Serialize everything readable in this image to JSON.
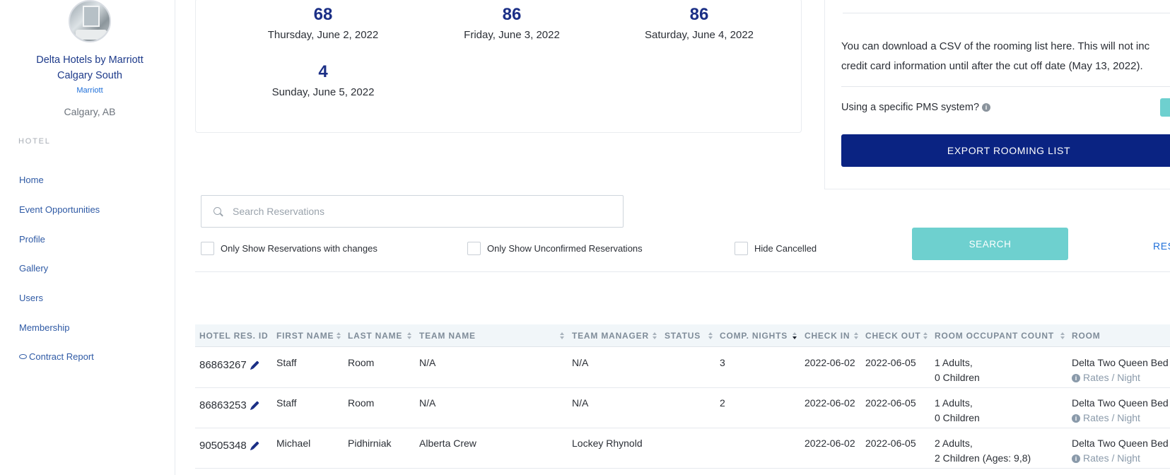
{
  "sidebar": {
    "hotel_name_line1": "Delta Hotels by Marriott",
    "hotel_name_line2": "Calgary South",
    "brand": "Marriott",
    "city": "Calgary, AB",
    "section_label": "HOTEL",
    "items": [
      {
        "label": "Home"
      },
      {
        "label": "Event Opportunities"
      },
      {
        "label": "Profile"
      },
      {
        "label": "Gallery"
      },
      {
        "label": "Users"
      },
      {
        "label": "Membership"
      },
      {
        "label": "Contract Report"
      }
    ]
  },
  "stats": [
    {
      "count": "68",
      "date": "Thursday, June 2, 2022"
    },
    {
      "count": "86",
      "date": "Friday, June 3, 2022"
    },
    {
      "count": "86",
      "date": "Saturday, June 4, 2022"
    },
    {
      "count": "4",
      "date": "Sunday, June 5, 2022"
    }
  ],
  "export": {
    "text_line1": "You can download a CSV of the rooming list here. This will not inc",
    "text_line2": "credit card information until after the cut off date (May 13, 2022).",
    "pms_label": "Using a specific PMS system?",
    "info_glyph": "i",
    "button_label": "EXPORT ROOMING LIST"
  },
  "search": {
    "placeholder": "Search Reservations",
    "value": "",
    "filters": [
      {
        "label": "Only Show Reservations with changes"
      },
      {
        "label": "Only Show Unconfirmed Reservations"
      },
      {
        "label": "Hide Cancelled"
      }
    ],
    "search_button": "SEARCH",
    "reset_link": "RES"
  },
  "table": {
    "headers": [
      "HOTEL RES. ID",
      "FIRST NAME",
      "LAST NAME",
      "TEAM NAME",
      "TEAM MANAGER",
      "STATUS",
      "COMP. NIGHTS",
      "CHECK IN",
      "CHECK OUT",
      "ROOM OCCUPANT COUNT",
      "ROOM"
    ],
    "rows": [
      {
        "id": "86863267",
        "first": "Staff",
        "last": "Room",
        "team": "N/A",
        "manager": "N/A",
        "status": "",
        "comp": "3",
        "checkin": "2022-06-02",
        "checkout": "2022-06-05",
        "occ1": "1 Adults,",
        "occ2": "0 Children",
        "room": "Delta Two Queen Bed",
        "rates": "Rates / Night"
      },
      {
        "id": "86863253",
        "first": "Staff",
        "last": "Room",
        "team": "N/A",
        "manager": "N/A",
        "status": "",
        "comp": "2",
        "checkin": "2022-06-02",
        "checkout": "2022-06-05",
        "occ1": "1 Adults,",
        "occ2": "0 Children",
        "room": "Delta Two Queen Bed",
        "rates": "Rates / Night"
      },
      {
        "id": "90505348",
        "first": "Michael",
        "last": "Pidhirniak",
        "team": "Alberta Crew",
        "manager": "Lockey Rhynold",
        "status": "",
        "comp": "",
        "checkin": "2022-06-02",
        "checkout": "2022-06-05",
        "occ1": "2 Adults,",
        "occ2": "2 Children (Ages: 9,8)",
        "room": "Delta Two Queen Bed",
        "rates": "Rates / Night"
      }
    ]
  }
}
